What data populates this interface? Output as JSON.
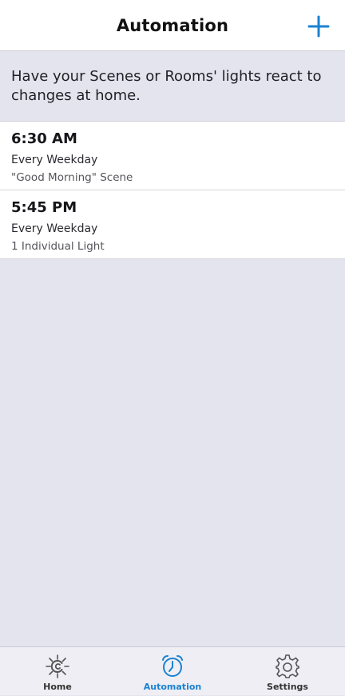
{
  "header": {
    "title": "Automation"
  },
  "intro": {
    "text": "Have your Scenes or Rooms' lights react to changes at home."
  },
  "automations": [
    {
      "time": "6:30 AM",
      "schedule": "Every Weekday",
      "target": "\"Good Morning\" Scene"
    },
    {
      "time": "5:45 PM",
      "schedule": "Every Weekday",
      "target": "1 Individual Light"
    }
  ],
  "tabs": [
    {
      "label": "Home",
      "icon": "home-sun-icon"
    },
    {
      "label": "Automation",
      "icon": "alarm-clock-icon",
      "active": true
    },
    {
      "label": "Settings",
      "icon": "gear-icon"
    }
  ],
  "colors": {
    "accent": "#1a82d1",
    "background": "#e4e4ef",
    "card": "#ffffff"
  }
}
